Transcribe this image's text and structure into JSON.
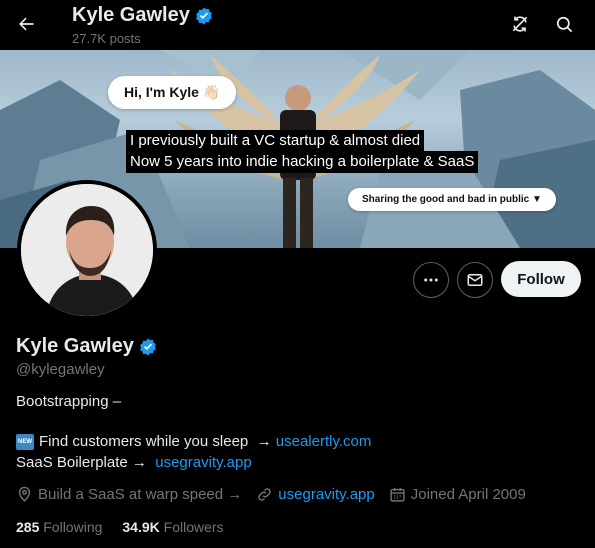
{
  "header": {
    "name": "Kyle Gawley",
    "posts": "27.7K posts"
  },
  "banner": {
    "speech": "Hi, I'm Kyle 👋🏻",
    "caption_line1": "I previously built a VC startup & almost died",
    "caption_line2": "Now 5 years into indie hacking a boilerplate & SaaS",
    "pill": "Sharing the good and bad in public ▼"
  },
  "actions": {
    "follow_label": "Follow"
  },
  "profile": {
    "name": "Kyle Gawley",
    "handle": "@kylegawley",
    "bio_line1": "Bootstrapping –",
    "new_badge": "NEW",
    "bio_line2_text": "Find customers while you sleep  → ",
    "bio_line2_link": "usealertly.com",
    "bio_line3_text": "SaaS Boilerplate → ",
    "bio_line3_link": "usegravity.app",
    "location": "Build a SaaS at warp speed →",
    "website": "usegravity.app",
    "joined": "Joined April 2009",
    "following_count": "285",
    "following_label": "Following",
    "followers_count": "34.9K",
    "followers_label": "Followers"
  },
  "colors": {
    "accent": "#1d9bf0",
    "muted": "#71767b",
    "background": "#000000"
  },
  "icons": [
    "back-arrow-icon",
    "verified-badge-icon",
    "refresh-icon",
    "search-icon",
    "more-icon",
    "message-icon",
    "location-icon",
    "link-icon",
    "calendar-icon"
  ]
}
